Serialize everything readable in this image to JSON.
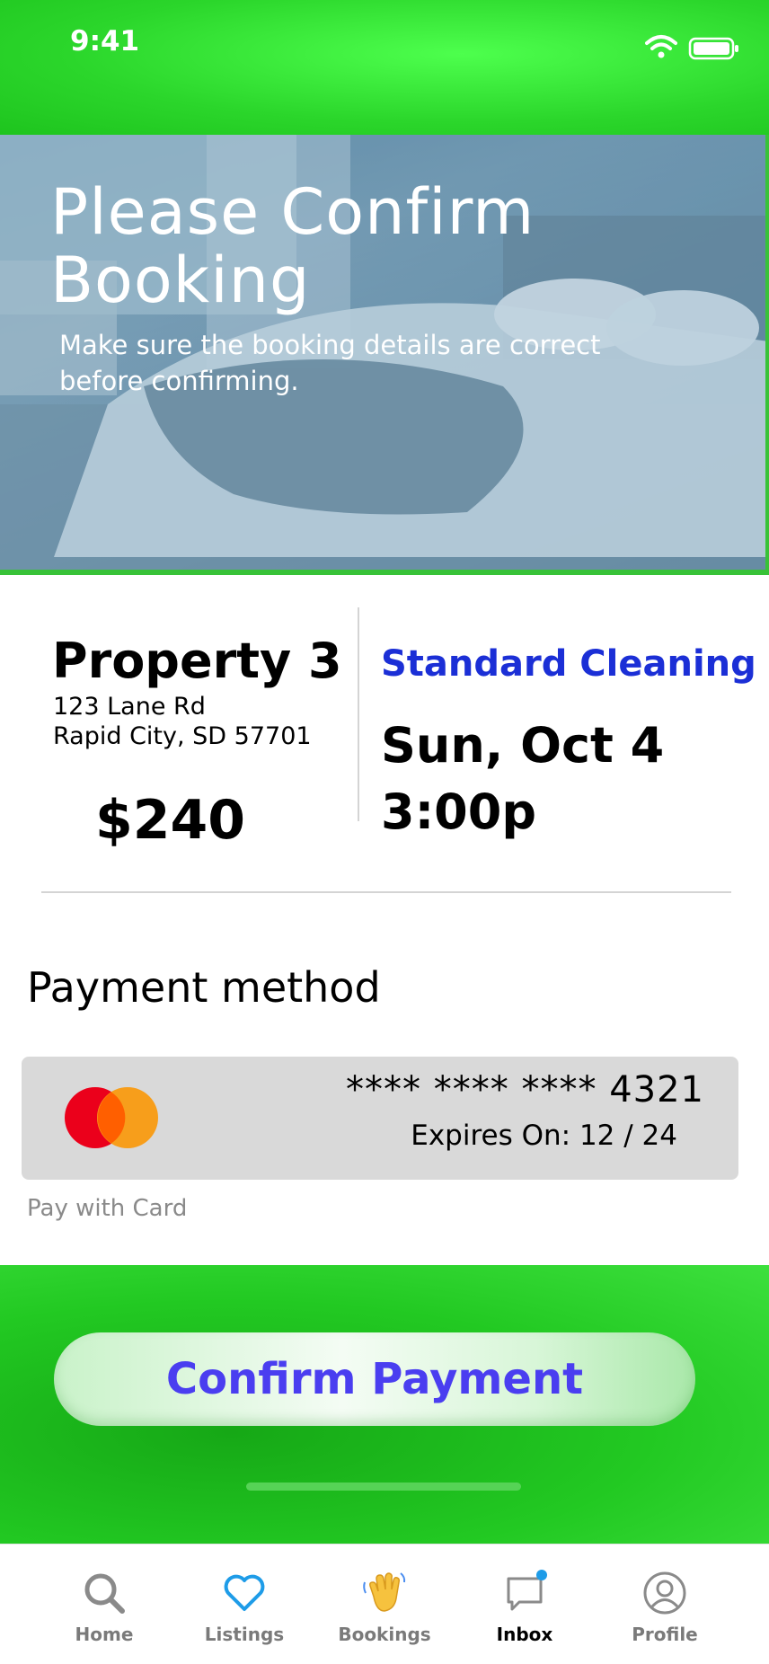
{
  "status_bar": {
    "time": "9:41",
    "icons": [
      "wifi-icon",
      "battery-icon"
    ]
  },
  "hero": {
    "title": "Please Confirm Booking",
    "subtitle": "Make sure the booking details are correct before confirming."
  },
  "booking": {
    "property_name": "Property 3",
    "address_line1": "123 Lane Rd",
    "address_line2": "Rapid City, SD 57701",
    "price": "$240",
    "service": "Standard Cleaning",
    "date": "Sun, Oct 4",
    "time": "3:00p"
  },
  "payment": {
    "heading": "Payment method",
    "card_number": "**** **** **** 4321",
    "expiry": "Expires On: 12 / 24",
    "card_brand_icon": "mastercard-icon",
    "pay_with_label": "Pay with Card"
  },
  "confirm": {
    "button_label": "Confirm Payment"
  },
  "tabs": [
    {
      "label": "Home",
      "icon": "search-icon"
    },
    {
      "label": "Listings",
      "icon": "heart-icon"
    },
    {
      "label": "Bookings",
      "icon": "waving-hand-icon"
    },
    {
      "label": "Inbox",
      "icon": "chat-bubble-icon"
    },
    {
      "label": "Profile",
      "icon": "user-circle-icon"
    }
  ],
  "colors": {
    "brand_green": "#2bd62b",
    "service_blue": "#1b2fd6",
    "confirm_text": "#4a3ef0",
    "listings_accent": "#1e9ce8"
  }
}
